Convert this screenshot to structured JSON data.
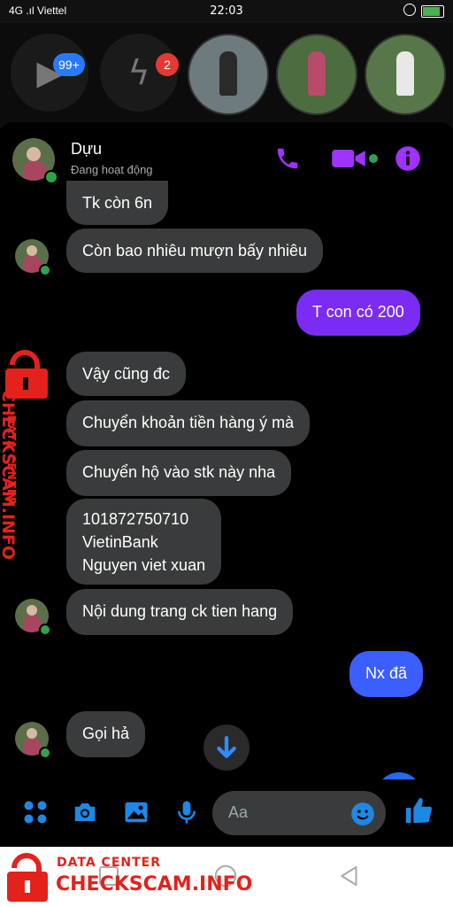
{
  "status_bar": {
    "carrier": "4G .ıl Viettel",
    "time": "22:03"
  },
  "stories": {
    "badges": [
      "99+",
      "2"
    ]
  },
  "header": {
    "name": "Dựu",
    "status": "Đang hoạt động",
    "icons": [
      "phone-icon",
      "video-icon",
      "info-icon"
    ]
  },
  "messages": [
    {
      "side": "in",
      "text": "Tk còn 6n"
    },
    {
      "side": "in",
      "text": "Còn bao nhiêu mượn bấy nhiêu"
    },
    {
      "side": "out",
      "text": "T con có 200"
    },
    {
      "side": "in",
      "text": "Vậy cũng đc"
    },
    {
      "side": "in",
      "text": "Chuyển khoản tiền hàng ý mà"
    },
    {
      "side": "in",
      "text": "Chuyển hộ vào stk này nha"
    },
    {
      "side": "in",
      "lines": [
        "101872750710",
        "VietinBank",
        "Nguyen viet xuan"
      ]
    },
    {
      "side": "in",
      "text": "Nội dung trang ck tien hang"
    },
    {
      "side": "out",
      "text": "Nx đã"
    },
    {
      "side": "in",
      "text": "Gọi hả"
    }
  ],
  "composer": {
    "placeholder": "Aa"
  },
  "watermark": {
    "small": "DATA CENTER",
    "big": "CHECKSCAM.INFO"
  },
  "colors": {
    "accent": "#A033FF",
    "out_bubble": "#7B2CF2",
    "out_bubble_blue": "#3A5EFF",
    "in_bubble": "#3A3B3C",
    "composer_icons": "#1E88E5",
    "watermark": "#E3221C"
  }
}
